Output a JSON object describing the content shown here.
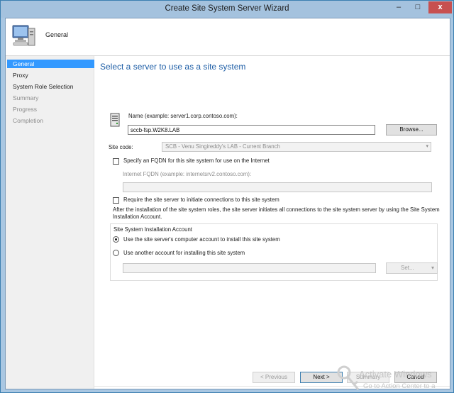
{
  "window": {
    "title": "Create Site System Server Wizard",
    "close_glyph": "x",
    "minimize_glyph": "–",
    "maximize_glyph": "□"
  },
  "header": {
    "title": "General",
    "icon": "computer-icon"
  },
  "nav": {
    "items": [
      {
        "label": "General",
        "state": "active"
      },
      {
        "label": "Proxy",
        "state": "normal"
      },
      {
        "label": "System Role Selection",
        "state": "normal"
      },
      {
        "label": "Summary",
        "state": "dim"
      },
      {
        "label": "Progress",
        "state": "dim"
      },
      {
        "label": "Completion",
        "state": "dim"
      }
    ]
  },
  "main": {
    "heading": "Select a server to use as a site system",
    "name_label": "Name (example: server1.corp.contoso.com):",
    "name_value": "sccb-fsp.W2K8.LAB",
    "browse_label": "Browse...",
    "site_code_label": "Site code:",
    "site_code_value": "SCB - Venu Singireddy's LAB - Current Branch",
    "fqdn_checkbox_label": "Specify an FQDN for this site system for use on the Internet",
    "internet_fqdn_label": "Internet FQDN (example: internetsrv2.contoso.com):",
    "internet_fqdn_value": "",
    "require_checkbox_label": "Require the site server to initiate connections to this site system",
    "info_text": "After the  installation of the site system roles, the site server initiates all connections to the site system server by using the Site System Installation Account.",
    "install_account_group": "Site System Installation Account",
    "radio_computer_account": "Use the site server's computer account to install this site system",
    "radio_another_account": "Use another account for installing this site system",
    "account_value": "",
    "set_label": "Set...",
    "set_arrow": "▾"
  },
  "footer": {
    "previous_label": "< Previous",
    "next_label": "Next >",
    "summary_label": "Summary",
    "cancel_label": "Cancel"
  },
  "watermark": {
    "line1": "Activate Windows",
    "line2": "Go to Action Center to a"
  },
  "colors": {
    "accent": "#3399ff",
    "heading": "#1e5ea6",
    "titlebar": "#a4c2de",
    "close_button": "#c75050"
  }
}
